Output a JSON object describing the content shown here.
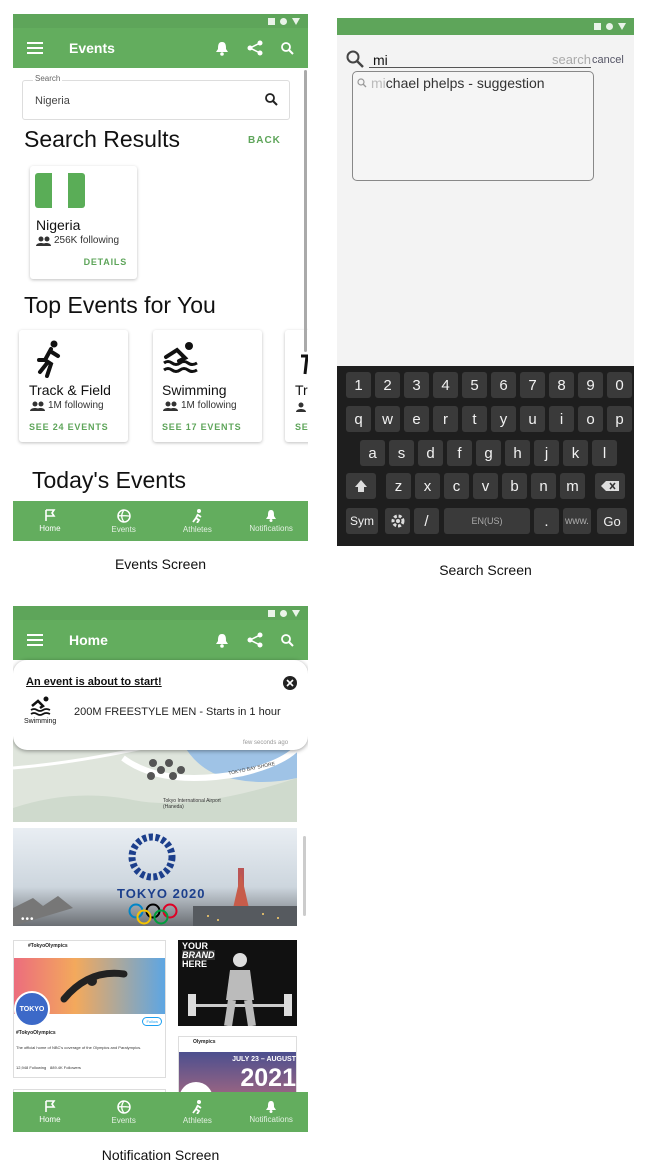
{
  "events_screen": {
    "appbar_title": "Events",
    "search_label": "Search",
    "search_value": "Nigeria",
    "search_results_heading": "Search Results",
    "back_label": "BACK",
    "result_card": {
      "name": "Nigeria",
      "followers": "256K following",
      "details_label": "DETAILS"
    },
    "top_events_heading": "Top Events for You",
    "event_cards": [
      {
        "name": "Track & Field",
        "followers": "1M following",
        "cta": "SEE 24 EVENTS"
      },
      {
        "name": "Swimming",
        "followers": "1M following",
        "cta": "SEE 17 EVENTS"
      },
      {
        "name": "Tr",
        "followers": "",
        "cta": "SE"
      }
    ],
    "today_heading": "Today's Events",
    "caption": "Events Screen"
  },
  "bottom_nav": {
    "home": "Home",
    "events": "Events",
    "athletes": "Athletes",
    "notifications": "Notifications"
  },
  "search_screen": {
    "query_typed": "mi",
    "search_placeholder": "search",
    "cancel_label": "cancel",
    "suggestion_prefix": "mi",
    "suggestion_rest": "chael phelps - suggestion",
    "keyboard": {
      "row1": [
        "1",
        "2",
        "3",
        "4",
        "5",
        "6",
        "7",
        "8",
        "9",
        "0"
      ],
      "row2": [
        "q",
        "w",
        "e",
        "r",
        "t",
        "y",
        "u",
        "i",
        "o",
        "p"
      ],
      "row3": [
        "a",
        "s",
        "d",
        "f",
        "g",
        "h",
        "j",
        "k",
        "l"
      ],
      "row4": [
        "z",
        "x",
        "c",
        "v",
        "b",
        "n",
        "m"
      ],
      "sym": "Sym",
      "space": "EN(US)",
      "slash": "/",
      "dot": ".",
      "www": "www.",
      "go": "Go"
    },
    "caption": "Search Screen"
  },
  "notification_screen": {
    "appbar_title": "Home",
    "banner_title": "An event is about to start!",
    "banner_icon_label": "Swimming",
    "banner_message": "200M FREESTYLE MEN - Starts in 1 hour",
    "banner_time": "few seconds ago",
    "map_label_1": "Tokyo International Airport (Haneda)",
    "map_label_2": "TOKYO BAY SHORE",
    "tokyo_text": "TOKYO 2020",
    "tweet_handle": "#TokyoOlympics",
    "tweet_follow": "Follow",
    "tweet_bio": "The official home of NBC's coverage of the Olympics and Paralympics.",
    "tweet_following": "12,948 Following",
    "tweet_followers": "889.4K Followers",
    "ad_text_1": "YOUR",
    "ad_text_2": "BRAND",
    "ad_text_3": "HERE",
    "olympics_handle": "Olympics",
    "olympics_dates": "JULY 23 – AUGUST",
    "olympics_year": "2021",
    "caption": "Notification Screen"
  },
  "colors": {
    "primary": "#63ad5e",
    "status": "#5ea55a",
    "keyboard_bg": "#1e1e1e"
  }
}
